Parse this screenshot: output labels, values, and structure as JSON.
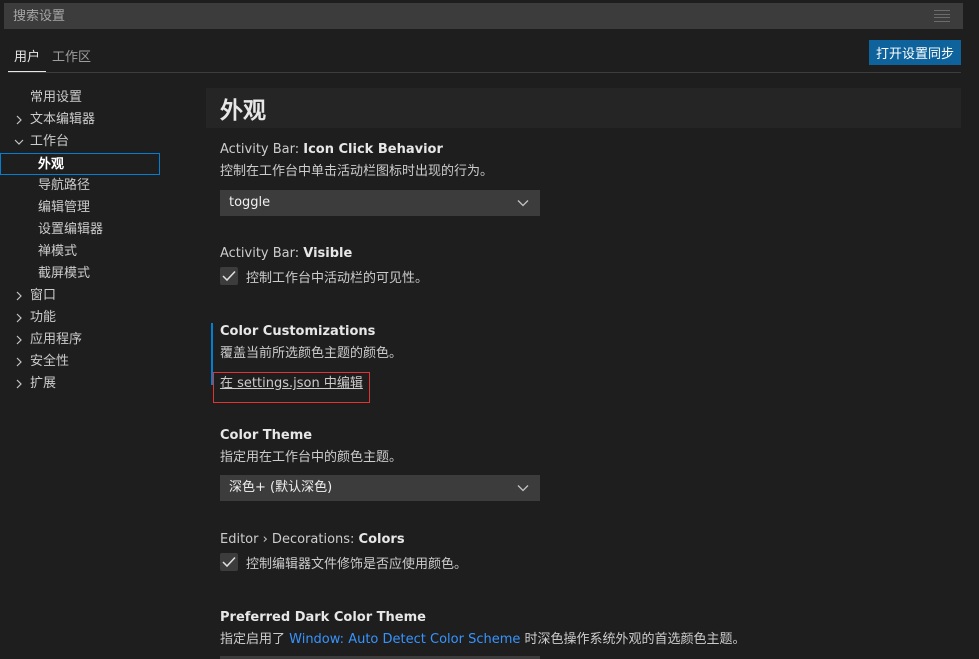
{
  "search": {
    "placeholder": "搜索设置",
    "filter_icon": "filter-icon"
  },
  "tabs": [
    {
      "label": "用户",
      "active": true
    },
    {
      "label": "工作区",
      "active": false
    }
  ],
  "sync_button": "打开设置同步",
  "toc": [
    {
      "label": "常用设置",
      "level": 0,
      "expandable": false
    },
    {
      "label": "文本编辑器",
      "level": 0,
      "expandable": true,
      "expanded": false
    },
    {
      "label": "工作台",
      "level": 0,
      "expandable": true,
      "expanded": true
    },
    {
      "label": "外观",
      "level": 1,
      "selected": true
    },
    {
      "label": "导航路径",
      "level": 1
    },
    {
      "label": "编辑管理",
      "level": 1
    },
    {
      "label": "设置编辑器",
      "level": 1
    },
    {
      "label": "禅模式",
      "level": 1
    },
    {
      "label": "截屏模式",
      "level": 1
    },
    {
      "label": "窗口",
      "level": 0,
      "expandable": true,
      "expanded": false
    },
    {
      "label": "功能",
      "level": 0,
      "expandable": true,
      "expanded": false
    },
    {
      "label": "应用程序",
      "level": 0,
      "expandable": true,
      "expanded": false
    },
    {
      "label": "安全性",
      "level": 0,
      "expandable": true,
      "expanded": false
    },
    {
      "label": "扩展",
      "level": 0,
      "expandable": true,
      "expanded": false
    }
  ],
  "section_title": "外观",
  "settings": {
    "icon_click": {
      "category": "Activity Bar: ",
      "name": "Icon Click Behavior",
      "description": "控制在工作台中单击活动栏图标时出现的行为。",
      "value": "toggle"
    },
    "visible": {
      "category": "Activity Bar: ",
      "name": "Visible",
      "description": "控制工作台中活动栏的可见性。",
      "checked": true
    },
    "color_customizations": {
      "name": "Color Customizations",
      "description": "覆盖当前所选颜色主题的颜色。",
      "link": "在 settings.json 中编辑"
    },
    "color_theme": {
      "name": "Color Theme",
      "description": "指定用在工作台中的颜色主题。",
      "value": "深色+ (默认深色)"
    },
    "decorations": {
      "category": "Editor › Decorations: ",
      "name": "Colors",
      "description": "控制编辑器文件修饰是否应使用颜色。",
      "checked": true
    },
    "preferred_dark": {
      "name": "Preferred Dark Color Theme",
      "desc_prefix": "指定启用了 ",
      "desc_link": "Window: Auto Detect Color Scheme",
      "desc_suffix": " 时深色操作系统外观的首选颜色主题。"
    }
  },
  "colors": {
    "background": "#1e1e1e",
    "accent": "#0e639c",
    "focus": "#007fd4",
    "link": "#3794ff",
    "highlight_box": "#e03434"
  }
}
